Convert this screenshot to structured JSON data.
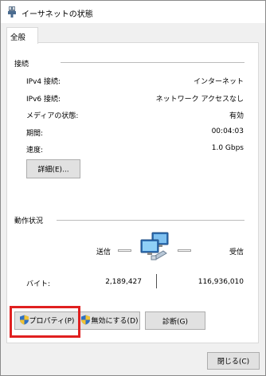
{
  "window": {
    "title": "イーサネットの状態"
  },
  "tabs": [
    {
      "label": "全般"
    }
  ],
  "connection": {
    "group_label": "接続",
    "rows": [
      {
        "label": "IPv4 接続:",
        "value": "インターネット"
      },
      {
        "label": "IPv6 接続:",
        "value": "ネットワーク アクセスなし"
      },
      {
        "label": "メディアの状態:",
        "value": "有効"
      },
      {
        "label": "期間:",
        "value": "00:04:03"
      },
      {
        "label": "速度:",
        "value": "1.0 Gbps"
      }
    ],
    "details_button": "詳細(E)..."
  },
  "activity": {
    "group_label": "動作状況",
    "sent_label": "送信",
    "received_label": "受信",
    "bytes_label": "バイト:",
    "bytes_sent": "2,189,427",
    "bytes_received": "116,936,010"
  },
  "actions": {
    "properties_button": "プロパティ(P)",
    "disable_button": "無効にする(D)",
    "diagnose_button": "診断(G)"
  },
  "footer": {
    "close_button": "閉じる(C)"
  },
  "colors": {
    "highlight": "#e02020",
    "window_bg": "#f0f0f0",
    "panel_bg": "#ffffff"
  },
  "icons": {
    "title": "ethernet-plug-icon",
    "network_activity": "network-computers-icon",
    "shield": "uac-shield-icon"
  }
}
